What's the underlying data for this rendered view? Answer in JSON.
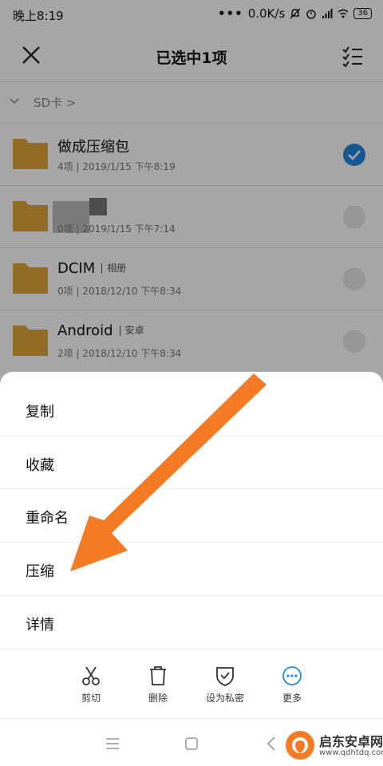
{
  "status": {
    "time": "晚上8:19",
    "dots": "•••",
    "speed": "0.0K/s",
    "battery": "36"
  },
  "header": {
    "title": "已选中1项"
  },
  "breadcrumb": {
    "label": "SD卡 >"
  },
  "files": [
    {
      "name": "做成压缩包",
      "tag": "",
      "meta": "4项 | 2019/1/15 下午8:19",
      "checked": true
    },
    {
      "name": "",
      "tag": "",
      "meta": "0项 | 2019/1/15 下午7:14",
      "checked": false
    },
    {
      "name": "DCIM",
      "tag": "相册",
      "meta": "0项 | 2018/12/10 下午8:34",
      "checked": false
    },
    {
      "name": "Android",
      "tag": "安卓",
      "meta": "2项 | 2018/12/10 下午8:34",
      "checked": false
    }
  ],
  "menu": [
    {
      "label": "复制"
    },
    {
      "label": "收藏"
    },
    {
      "label": "重命名"
    },
    {
      "label": "压缩"
    },
    {
      "label": "详情"
    }
  ],
  "actions": [
    {
      "label": "剪切",
      "icon": "scissors-icon"
    },
    {
      "label": "删除",
      "icon": "trash-icon"
    },
    {
      "label": "设为私密",
      "icon": "shield-icon"
    },
    {
      "label": "更多",
      "icon": "more-icon"
    }
  ],
  "watermark": {
    "name": "启东安卓网",
    "url": "www.qdhtdq.com"
  },
  "colors": {
    "accent": "#1e88e5",
    "folder": "#e0a53a",
    "arrow": "#f47a24"
  }
}
